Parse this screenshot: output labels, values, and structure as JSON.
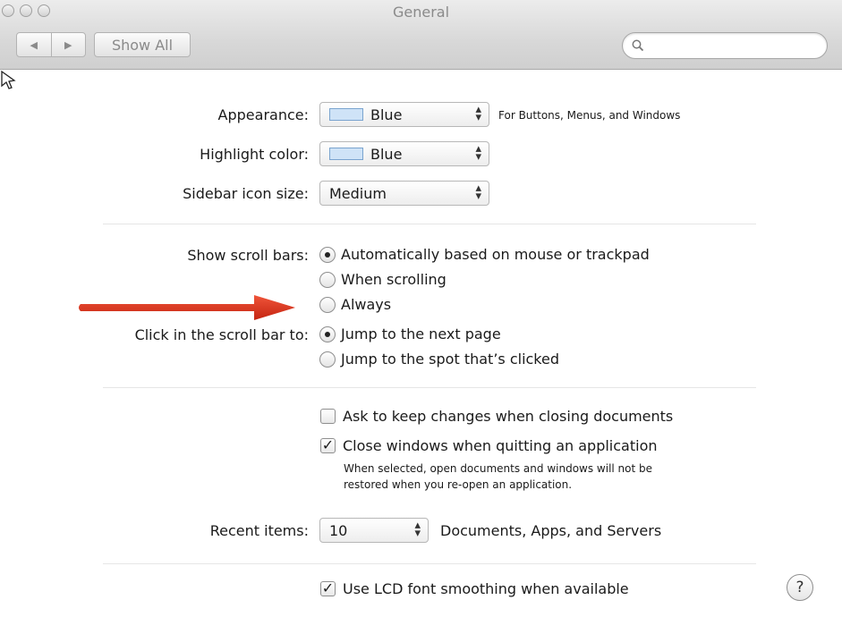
{
  "window": {
    "title": "General"
  },
  "toolbar": {
    "back_label": "◀",
    "forward_label": "▶",
    "show_all_label": "Show All",
    "search_placeholder": ""
  },
  "appearance": {
    "label": "Appearance:",
    "value": "Blue",
    "note": "For Buttons, Menus, and Windows",
    "swatch_color": "#cfe3f7"
  },
  "highlight": {
    "label": "Highlight color:",
    "value": "Blue",
    "swatch_color": "#cfe3f7"
  },
  "sidebar_icon": {
    "label": "Sidebar icon size:",
    "value": "Medium"
  },
  "scroll_bars": {
    "label": "Show scroll bars:",
    "options": [
      {
        "label": "Automatically based on mouse or trackpad",
        "selected": true
      },
      {
        "label": "When scrolling",
        "selected": false
      },
      {
        "label": "Always",
        "selected": false
      }
    ]
  },
  "click_scroll": {
    "label": "Click in the scroll bar to:",
    "options": [
      {
        "label": "Jump to the next page",
        "selected": true
      },
      {
        "label": "Jump to the spot that’s clicked",
        "selected": false
      }
    ]
  },
  "documents": {
    "ask_keep_changes": {
      "label": "Ask to keep changes when closing documents",
      "checked": false
    },
    "close_windows": {
      "label": "Close windows when quitting an application",
      "checked": true
    },
    "note_line1": "When selected, open documents and windows will not be",
    "note_line2": "restored when you re-open an application."
  },
  "recent_items": {
    "label": "Recent items:",
    "value": "10",
    "note": "Documents, Apps, and Servers"
  },
  "lcd_smoothing": {
    "label": "Use LCD font smoothing when available",
    "checked": true
  },
  "help": {
    "label": "?"
  },
  "colors": {
    "annotation_arrow": "#d9331c",
    "accent": "#7aa4cf"
  }
}
